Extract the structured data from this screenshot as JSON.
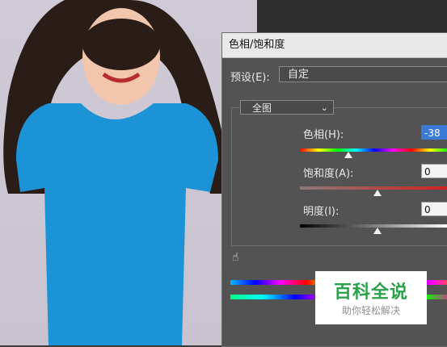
{
  "dialog": {
    "title": "色相/饱和度",
    "preset_label": "预设(E):",
    "preset_value": "自定",
    "channel_value": "全图"
  },
  "sliders": {
    "hue": {
      "label": "色相(H):",
      "value": "-38"
    },
    "saturation": {
      "label": "饱和度(A):",
      "value": "0"
    },
    "lightness": {
      "label": "明度(I):",
      "value": "0"
    }
  },
  "watermark": {
    "title": "百科全说",
    "subtitle": "助你轻松解决"
  },
  "colors": {
    "shirt": "#1b93d6",
    "dialog_bg": "#535353",
    "highlight": "#3b7bd6",
    "arrow": "#c0161b"
  },
  "icons": {
    "hand": "hand-icon",
    "dropdown": "chevron-down-icon"
  }
}
